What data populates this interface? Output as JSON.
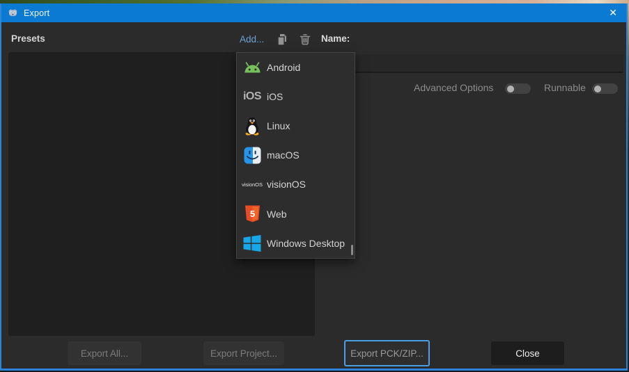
{
  "window": {
    "title": "Export",
    "close_glyph": "✕"
  },
  "presets_panel": {
    "header": "Presets"
  },
  "toolbar": {
    "add_label": "Add...",
    "name_label": "Name:",
    "name_value": ""
  },
  "platform_menu": {
    "items": [
      {
        "label": "Android",
        "icon": "android-icon"
      },
      {
        "label": "iOS",
        "icon": "ios-icon",
        "icon_text": "iOS"
      },
      {
        "label": "Linux",
        "icon": "linux-tux-icon"
      },
      {
        "label": "macOS",
        "icon": "macos-finder-icon"
      },
      {
        "label": "visionOS",
        "icon": "visionos-icon",
        "icon_text": "visionOS"
      },
      {
        "label": "Web",
        "icon": "html5-icon",
        "icon_text": "5"
      },
      {
        "label": "Windows Desktop",
        "icon": "windows-icon"
      }
    ]
  },
  "options": {
    "advanced_options": {
      "label": "Advanced Options",
      "enabled": false
    },
    "runnable": {
      "label": "Runnable",
      "enabled": false
    }
  },
  "footer": {
    "export_all": "Export All...",
    "export_project": "Export Project...",
    "export_pck": "Export PCK/ZIP...",
    "close": "Close"
  },
  "colors": {
    "titlebar_blue": "#0b7ad3",
    "window_border_blue": "#2b85d8",
    "focus_blue": "#4aa0e6",
    "link_blue": "#6da3d8",
    "android_green": "#76c15c",
    "html5_orange": "#e44d26",
    "windows_blue": "#17a7e8",
    "tux_orange": "#f6a51f"
  }
}
